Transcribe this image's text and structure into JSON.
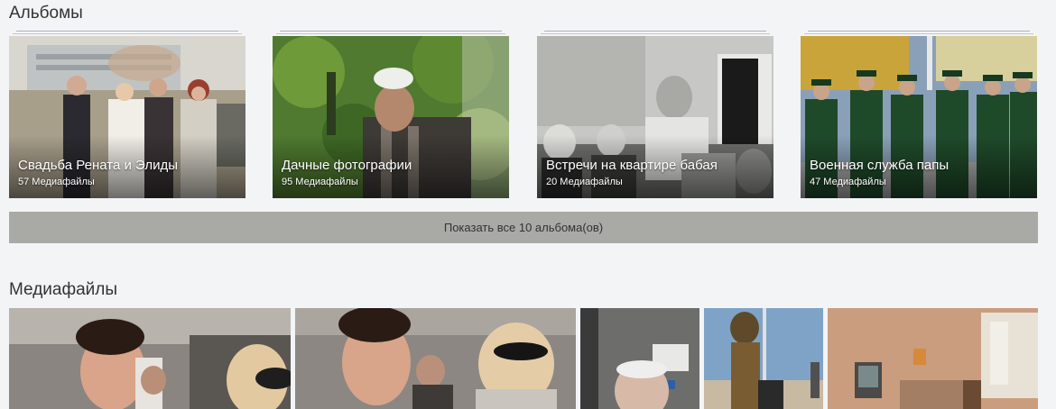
{
  "albums_section": {
    "title": "Альбомы",
    "albums": [
      {
        "name": "Свадьба Рената и Элиды",
        "count": "57 Медиафайлы"
      },
      {
        "name": "Дачные фотографии",
        "count": "95 Медиафайлы"
      },
      {
        "name": "Встречи на квартире бабая",
        "count": "20 Медиафайлы"
      },
      {
        "name": "Военная служба папы",
        "count": "47 Медиафайлы"
      }
    ],
    "show_all_label": "Показать все 10 альбома(ов)"
  },
  "media_section": {
    "title": "Медиафайлы"
  }
}
